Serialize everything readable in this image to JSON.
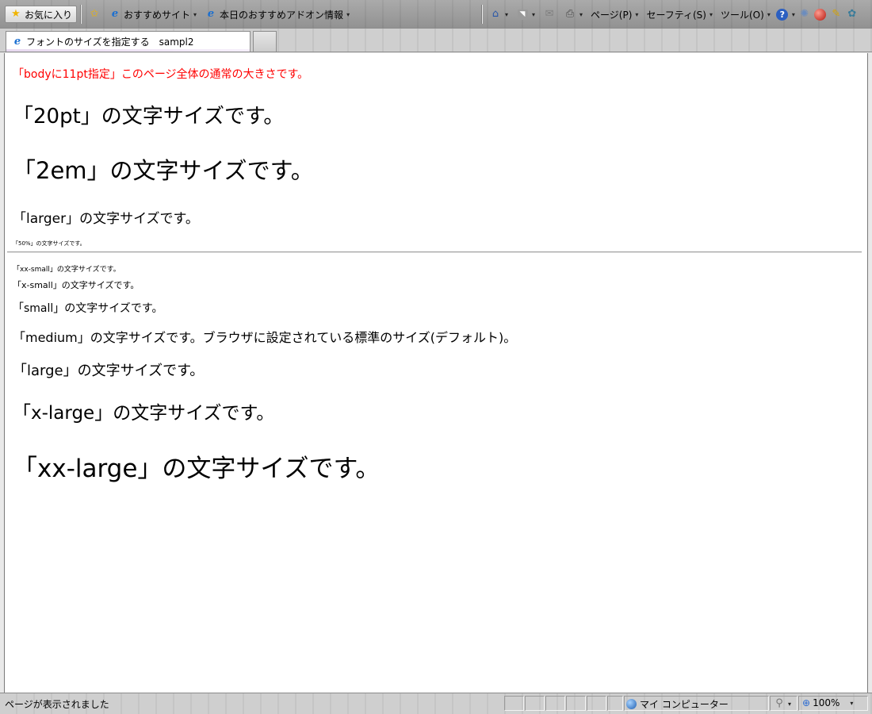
{
  "commandbar": {
    "favorites_label": "お気に入り",
    "recommended_sites_label": "おすすめサイト",
    "addons_label": "本日のおすすめアドオン情報",
    "page_label": "ページ(P)",
    "safety_label": "セーフティ(S)",
    "tools_label": "ツール(O)",
    "dropdown_glyph": "▾"
  },
  "tab": {
    "title": "フォントのサイズを指定する　sampl2"
  },
  "content": {
    "body_note": "「bodyに11pt指定」このページ全体の通常の大きさです。",
    "line_20pt": "「20pt」の文字サイズです。",
    "line_2em": "「2em」の文字サイズです。",
    "line_larger": "「larger」の文字サイズです。",
    "line_50pct": "「50%」の文字サイズです。",
    "line_xx_small": "「xx-small」の文字サイズです。",
    "line_x_small": "「x-small」の文字サイズです。",
    "line_small": "「small」の文字サイズです。",
    "line_medium": "「medium」の文字サイズです。ブラウザに設定されている標準のサイズ(デフォルト)。",
    "line_large": "「large」の文字サイズです。",
    "line_x_large": "「x-large」の文字サイズです。",
    "line_xx_large": "「xx-large」の文字サイズです。"
  },
  "statusbar": {
    "status_text": "ページが表示されました",
    "zone_label": "マイ コンピューター",
    "zoom_label": "100%"
  },
  "colors": {
    "body_note_text": "#ff0000",
    "page_background": "#ffffff"
  }
}
